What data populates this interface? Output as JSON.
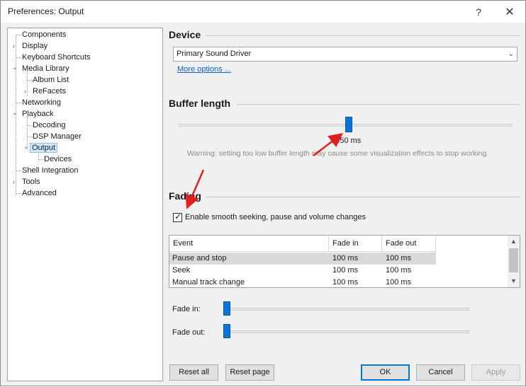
{
  "window": {
    "title": "Preferences: Output",
    "help_glyph": "?",
    "close_glyph": "✕"
  },
  "tree": {
    "items": [
      {
        "label": "Components"
      },
      {
        "label": "Display",
        "expander": "›"
      },
      {
        "label": "Keyboard Shortcuts"
      },
      {
        "label": "Media Library",
        "expander": "⌄"
      },
      {
        "label": "Album List"
      },
      {
        "label": "ReFacets",
        "expander": "›"
      },
      {
        "label": "Networking"
      },
      {
        "label": "Playback",
        "expander": "⌄"
      },
      {
        "label": "Decoding"
      },
      {
        "label": "DSP Manager"
      },
      {
        "label": "Output",
        "expander": "⌄"
      },
      {
        "label": "Devices"
      },
      {
        "label": "Shell Integration"
      },
      {
        "label": "Tools",
        "expander": "›"
      },
      {
        "label": "Advanced"
      }
    ]
  },
  "device": {
    "heading": "Device",
    "selected": "Primary Sound Driver",
    "more_options": "More options ..."
  },
  "buffer": {
    "heading": "Buffer length",
    "value_label": "3450 ms",
    "warning": "Warning: setting too low buffer length may cause some visualization effects to stop working."
  },
  "fading": {
    "heading": "Fading",
    "enable_label": "Enable smooth seeking, pause and volume changes",
    "enabled": true,
    "columns": [
      "Event",
      "Fade in",
      "Fade out"
    ],
    "rows": [
      {
        "event": "Pause and stop",
        "fade_in": "100 ms",
        "fade_out": "100 ms",
        "selected": true
      },
      {
        "event": "Seek",
        "fade_in": "100 ms",
        "fade_out": "100 ms",
        "selected": false
      },
      {
        "event": "Manual track change",
        "fade_in": "100 ms",
        "fade_out": "100 ms",
        "selected": false
      }
    ],
    "fade_in_label": "Fade in:",
    "fade_out_label": "Fade out:"
  },
  "buttons": {
    "reset_all": "Reset all",
    "reset_page": "Reset page",
    "ok": "OK",
    "cancel": "Cancel",
    "apply": "Apply"
  },
  "colors": {
    "accent": "#0a74da",
    "annotation": "#e02020",
    "selection": "#cce8ff"
  }
}
